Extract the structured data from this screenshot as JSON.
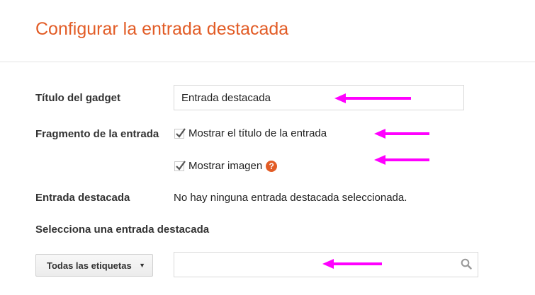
{
  "header": {
    "title": "Configurar la entrada destacada"
  },
  "form": {
    "gadget_title": {
      "label": "Título del gadget",
      "value": "Entrada destacada"
    },
    "fragment": {
      "label": "Fragmento de la entrada",
      "options": [
        {
          "label": "Mostrar el título de la entrada",
          "checked": true
        },
        {
          "label": "Mostrar imagen",
          "checked": true,
          "help": "?"
        }
      ]
    },
    "featured_post": {
      "label": "Entrada destacada",
      "value": "No hay ninguna entrada destacada seleccionada."
    },
    "select_section": {
      "label": "Selecciona una entrada destacada"
    },
    "labels_dropdown": {
      "selected": "Todas las etiquetas"
    },
    "search": {
      "value": "",
      "placeholder": ""
    }
  },
  "colors": {
    "accent": "#e25c26",
    "annotation": "#ff00ff"
  },
  "icons": {
    "search": "search-icon",
    "help": "help-icon",
    "dropdown": "caret-down-icon",
    "check": "checkmark-icon"
  }
}
